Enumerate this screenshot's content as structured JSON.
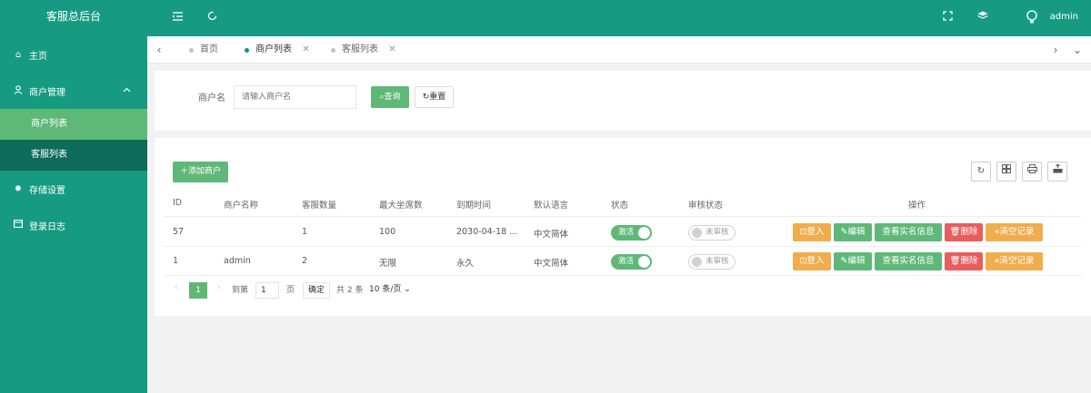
{
  "app": {
    "title": "客服总后台"
  },
  "header": {
    "user": "admin"
  },
  "sidebar": {
    "items": [
      {
        "label": "主页",
        "icon": "home-icon"
      },
      {
        "label": "商户管理",
        "icon": "user-icon"
      },
      {
        "label": "存储设置",
        "icon": "gear-icon"
      },
      {
        "label": "登录日志",
        "icon": "calendar-icon"
      }
    ],
    "subitems": [
      {
        "label": "商户列表"
      },
      {
        "label": "客服列表"
      }
    ]
  },
  "tabs": [
    {
      "label": "首页"
    },
    {
      "label": "商户列表"
    },
    {
      "label": "客服列表"
    }
  ],
  "search": {
    "label": "商户名",
    "placeholder": "请输入商户名",
    "query_label": "查询",
    "reset_label": "重置"
  },
  "toolbar": {
    "add_label": "添加商户"
  },
  "table": {
    "columns": [
      "ID",
      "商户名称",
      "客服数量",
      "最大坐席数",
      "到期时间",
      "默认语言",
      "状态",
      "审核状态",
      "操作"
    ],
    "rows": [
      {
        "id": "57",
        "name": "",
        "agents": "1",
        "max_seats": "100",
        "expire": "2030-04-18 ...",
        "lang": "中文简体",
        "status": "激活",
        "review": "未审核"
      },
      {
        "id": "1",
        "name": "admin",
        "agents": "2",
        "max_seats": "无限",
        "expire": "永久",
        "lang": "中文简体",
        "status": "激活",
        "review": "未审核"
      }
    ],
    "actions": {
      "login": "登入",
      "edit": "编辑",
      "view": "查看实名信息",
      "delete": "删除",
      "clear": "清空记录"
    }
  },
  "pagination": {
    "current": "1",
    "goto_label": "到第",
    "page_input": "1",
    "page_suffix": "页",
    "confirm": "确定",
    "total": "共 2 条",
    "per_page": "10 条/页"
  },
  "colors": {
    "primary": "#169b82",
    "green": "#5fb878",
    "orange": "#f0ad4e",
    "red": "#e85d5d"
  }
}
